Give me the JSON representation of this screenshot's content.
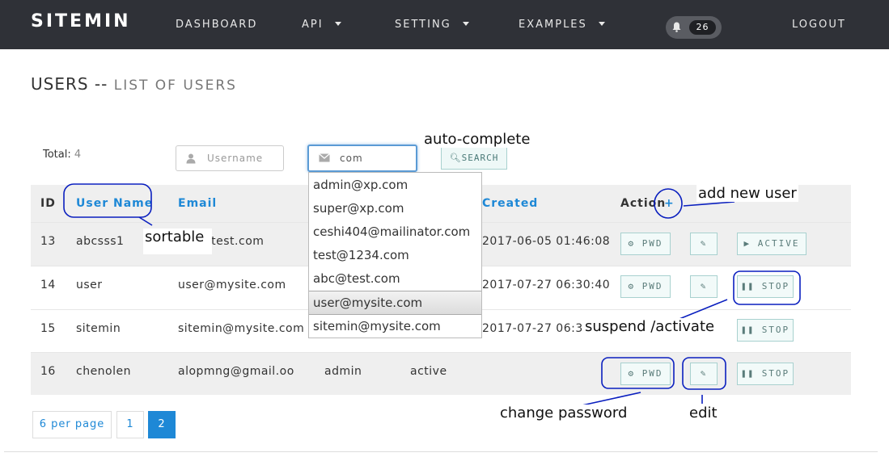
{
  "navbar": {
    "brand": "SITEMIN",
    "items": [
      "DASHBOARD",
      "API",
      "SETTING",
      "EXAMPLES",
      "LOGOUT"
    ],
    "notifications": "26"
  },
  "page": {
    "title": "USERS --",
    "subtitle": "LIST OF USERS"
  },
  "filter": {
    "total_label": "Total:",
    "total_value": "4",
    "username_placeholder": "Username",
    "email_value": "com",
    "search_label": "SEARCH"
  },
  "table": {
    "headers": {
      "id": "ID",
      "username": "User Name",
      "email": "Email",
      "created": "Created",
      "action": "Action",
      "add": "+"
    },
    "rows": [
      {
        "id": "13",
        "username": "abcsss1",
        "email": "abc@test.com",
        "created": "2017-06-05 01:46:08",
        "pwd": "PWD",
        "toggle": "ACTIVE"
      },
      {
        "id": "14",
        "username": "user",
        "email": "user@mysite.com",
        "created": "2017-07-27 06:30:40",
        "pwd": "PWD",
        "toggle": "STOP"
      },
      {
        "id": "15",
        "username": "sitemin",
        "email": "sitemin@mysite.com",
        "created": "2017-07-27 06:32:1",
        "pwd": "PWD",
        "toggle": "STOP"
      },
      {
        "id": "16",
        "username": "chenolen",
        "email": "alopmng@gmail.oo",
        "role": "admin",
        "status": "active",
        "pwd": "PWD",
        "toggle": "STOP"
      }
    ]
  },
  "autocomplete": [
    "admin@xp.com",
    "super@xp.com",
    "ceshi404@mailinator.com",
    "test@1234.com",
    "abc@test.com",
    "user@mysite.com",
    "sitemin@mysite.com"
  ],
  "pagination": {
    "per_page": "6 per page",
    "pages": [
      "1",
      "2"
    ],
    "current": "2"
  },
  "annotations": {
    "auto_complete": "auto-complete",
    "add_new_user": "add new user",
    "sortable": "sortable",
    "suspend": "suspend /activate",
    "change_password": "change password",
    "edit": "edit"
  },
  "colors": {
    "navbar": "#2f3137",
    "link": "#1e88d6",
    "annotation": "#0a1fbf"
  }
}
